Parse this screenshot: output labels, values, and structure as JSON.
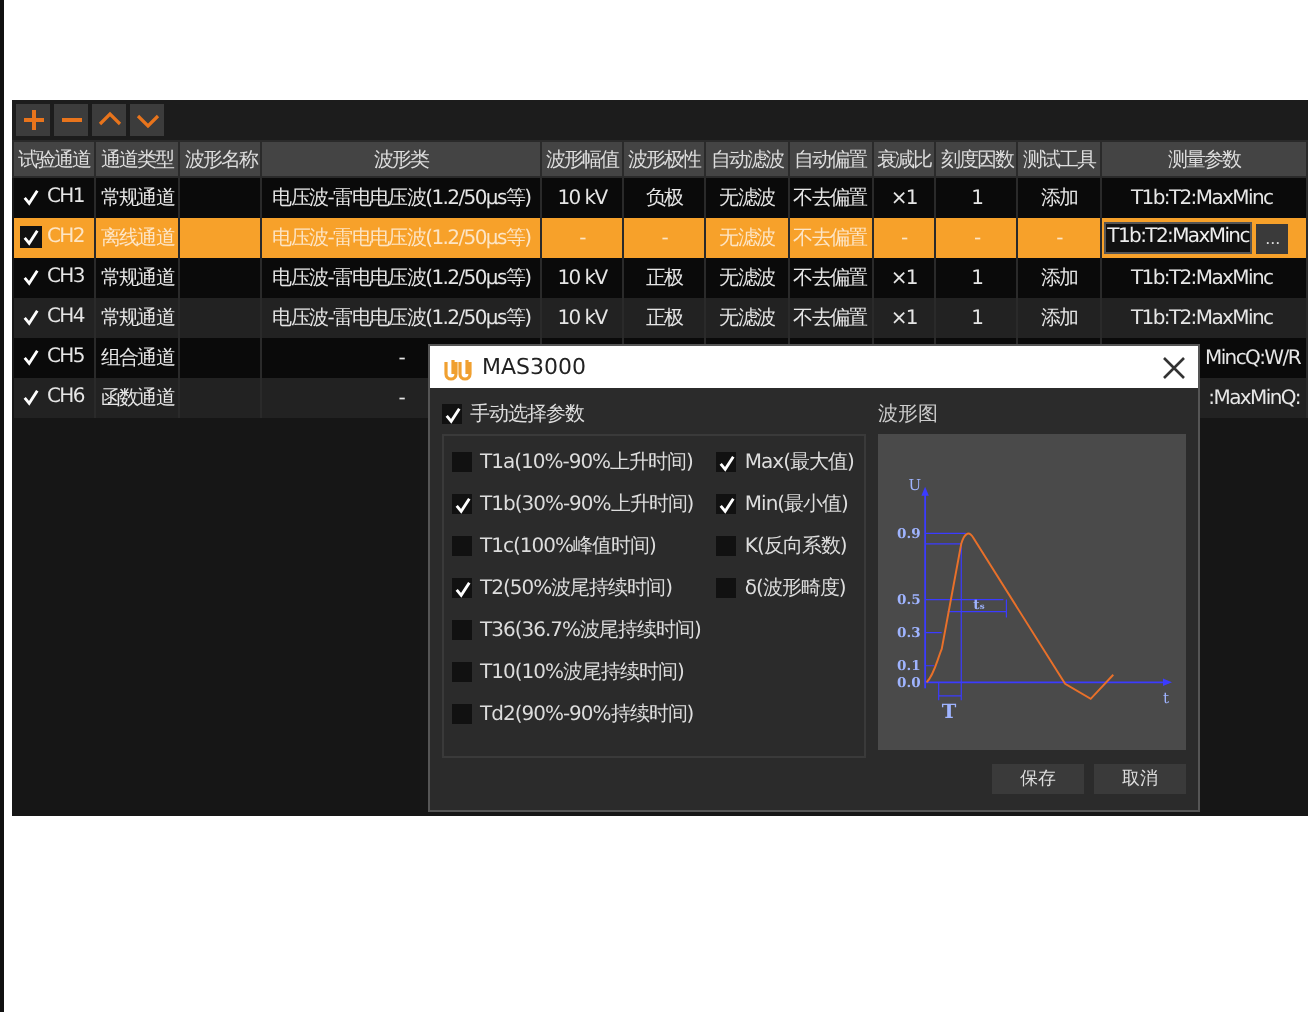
{
  "toolbar": {
    "buttons": [
      {
        "kind": "add"
      },
      {
        "kind": "remove"
      },
      {
        "kind": "up"
      },
      {
        "kind": "down"
      }
    ]
  },
  "table": {
    "columns": [
      "试验通道",
      "通道类型",
      "波形名称",
      "波形类",
      "波形幅值",
      "波形极性",
      "自动滤波",
      "自动偏置",
      "衰减比",
      "刻度因数",
      "测试工具",
      "测量参数"
    ],
    "rows": [
      {
        "checked": true,
        "selected": false,
        "channel": "CH1",
        "type": "常规通道",
        "wave": "电压波-雷电电压波(1.2/50μs等)",
        "amplitude": "10 kV",
        "polarity": "负极",
        "filter": "无滤波",
        "offset": "不去偏置",
        "ratio": "×1",
        "scale": "1",
        "tool": "添加",
        "param": "T1b:T2:MaxMinc"
      },
      {
        "checked": true,
        "selected": true,
        "channel": "CH2",
        "type": "离线通道",
        "wave": "电压波-雷电电压波(1.2/50μs等)",
        "amplitude": "-",
        "polarity": "-",
        "filter": "无滤波",
        "offset": "不去偏置",
        "ratio": "-",
        "scale": "-",
        "tool": "-",
        "param": "T1b:T2:MaxMinc",
        "param_button": "..."
      },
      {
        "checked": true,
        "selected": false,
        "channel": "CH3",
        "type": "常规通道",
        "wave": "电压波-雷电电压波(1.2/50μs等)",
        "amplitude": "10 kV",
        "polarity": "正极",
        "filter": "无滤波",
        "offset": "不去偏置",
        "ratio": "×1",
        "scale": "1",
        "tool": "添加",
        "param": "T1b:T2:MaxMinc"
      },
      {
        "checked": true,
        "selected": false,
        "channel": "CH4",
        "type": "常规通道",
        "wave": "电压波-雷电电压波(1.2/50μs等)",
        "amplitude": "10 kV",
        "polarity": "正极",
        "filter": "无滤波",
        "offset": "不去偏置",
        "ratio": "×1",
        "scale": "1",
        "tool": "添加",
        "param": "T1b:T2:MaxMinc"
      },
      {
        "checked": true,
        "selected": false,
        "channel": "CH5",
        "type": "组合通道",
        "wave": "-",
        "param": "MincQ:W/R"
      },
      {
        "checked": true,
        "selected": false,
        "channel": "CH6",
        "type": "函数通道",
        "wave": "-",
        "param": ":MaxMinQ:"
      }
    ]
  },
  "dialog": {
    "title": "MAS3000",
    "manual": {
      "label": "手动选择参数",
      "checked": true
    },
    "params_left": [
      {
        "label": "T1a(10%-90%上升时间)",
        "checked": false
      },
      {
        "label": "T1b(30%-90%上升时间)",
        "checked": true
      },
      {
        "label": "T1c(100%峰值时间)",
        "checked": false
      },
      {
        "label": "T2(50%波尾持续时间)",
        "checked": true
      },
      {
        "label": "T36(36.7%波尾持续时间)",
        "checked": false
      },
      {
        "label": "T10(10%波尾持续时间)",
        "checked": false
      },
      {
        "label": "Td2(90%-90%持续时间)",
        "checked": false
      }
    ],
    "params_right": [
      {
        "label": "Max(最大值)",
        "checked": true
      },
      {
        "label": "Min(最小值)",
        "checked": true
      },
      {
        "label": "K(反向系数)",
        "checked": false
      },
      {
        "label": "δ(波形畸度)",
        "checked": false
      }
    ],
    "diagram": {
      "label": "波形图",
      "y_axis": "U",
      "x_axis": "t",
      "ticks": [
        "0.9",
        "0.5",
        "0.3",
        "0.1",
        "0.0"
      ],
      "front_label": "T",
      "tail_label": "tₛ"
    },
    "buttons": [
      "保存",
      "取消"
    ]
  }
}
